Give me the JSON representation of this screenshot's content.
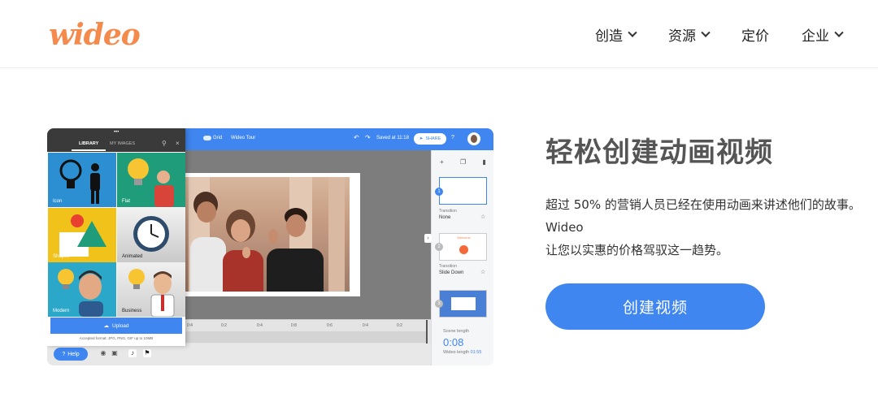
{
  "header": {
    "logo": "wideo",
    "nav": [
      {
        "label": "创造",
        "has_dropdown": true
      },
      {
        "label": "资源",
        "has_dropdown": true
      },
      {
        "label": "定价",
        "has_dropdown": false
      },
      {
        "label": "企业",
        "has_dropdown": true
      }
    ]
  },
  "editor": {
    "toolbar": {
      "grid_label": "Grid",
      "project_name": "Wideo Tour",
      "saved_status": "Saved at 11:18",
      "share_label": "SHARE"
    },
    "library": {
      "tabs": [
        "LIBRARY",
        "MY IMAGES"
      ],
      "tiles": [
        {
          "label": "Icon",
          "icon": "lightbulb-person-icon"
        },
        {
          "label": "Flat",
          "icon": "lightbulb-person-icon"
        },
        {
          "label": "Shapes",
          "icon": "shapes-icon"
        },
        {
          "label": "Animated",
          "icon": "clock-icon"
        },
        {
          "label": "Modern",
          "icon": "lightbulb-person-icon"
        },
        {
          "label": "Business",
          "icon": "lightbulb-person-icon"
        }
      ],
      "upload_label": "Upload",
      "upload_note": "Accepted format: JPG, PNG, GIF up to 10MB"
    },
    "timeline_ticks": [
      "0:4",
      "0:2",
      "0:4",
      "0:8",
      "0:6",
      "0:4",
      "0:2"
    ],
    "scenes": [
      {
        "number": "1",
        "transition_label": "Transition",
        "transition_value": "None"
      },
      {
        "number": "2",
        "transition_label": "Transition",
        "transition_value": "Slide Down",
        "thumb_text": "Welcome"
      },
      {
        "number": "3"
      }
    ],
    "scene_length_label": "Scene length",
    "scene_length": "0:08",
    "wideo_length_label": "Wideo length",
    "wideo_length": "01:55",
    "help_label": "Help"
  },
  "hero": {
    "title": "轻松创建动画视频",
    "desc_line1": "超过 50% 的营销人员已经在使用动画来讲述他们的故事。",
    "desc_line2": "Wideo",
    "desc_line3": "让您以实惠的价格驾驭这一趋势。",
    "cta_label": "创建视频"
  },
  "colors": {
    "brand_orange": "#f48a4c",
    "accent_blue": "#3f86f0"
  }
}
